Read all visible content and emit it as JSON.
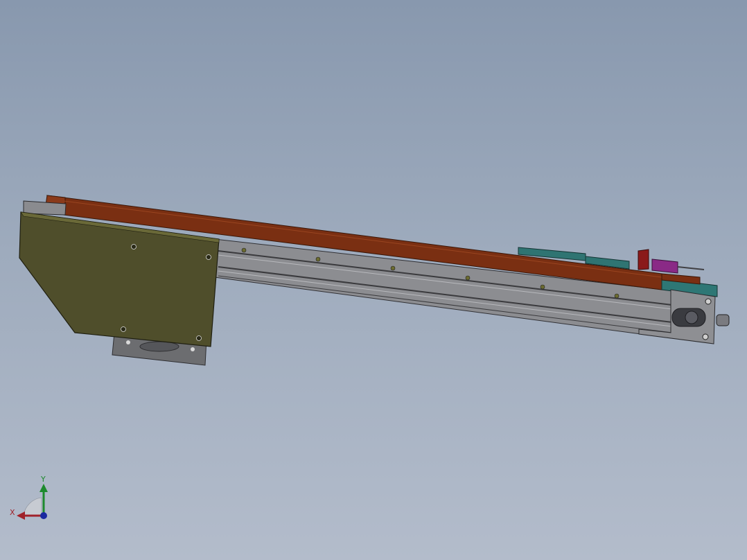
{
  "viewport": {
    "background_top": "#8898ae",
    "background_bottom": "#b3bccb"
  },
  "model": {
    "frame_color": "#4f4e2b",
    "rail_color": "#8e8f93",
    "belt_color": "#7a2f12",
    "board_color": "#2f7472",
    "magenta_part_color": "#8a2a86",
    "motor_plate_color": "#6a6a6e"
  },
  "triad": {
    "x_label": "X",
    "y_label": "Y",
    "x_color": "#a0222a",
    "y_color": "#1d8a2d",
    "z_color": "#1a2aa0"
  }
}
